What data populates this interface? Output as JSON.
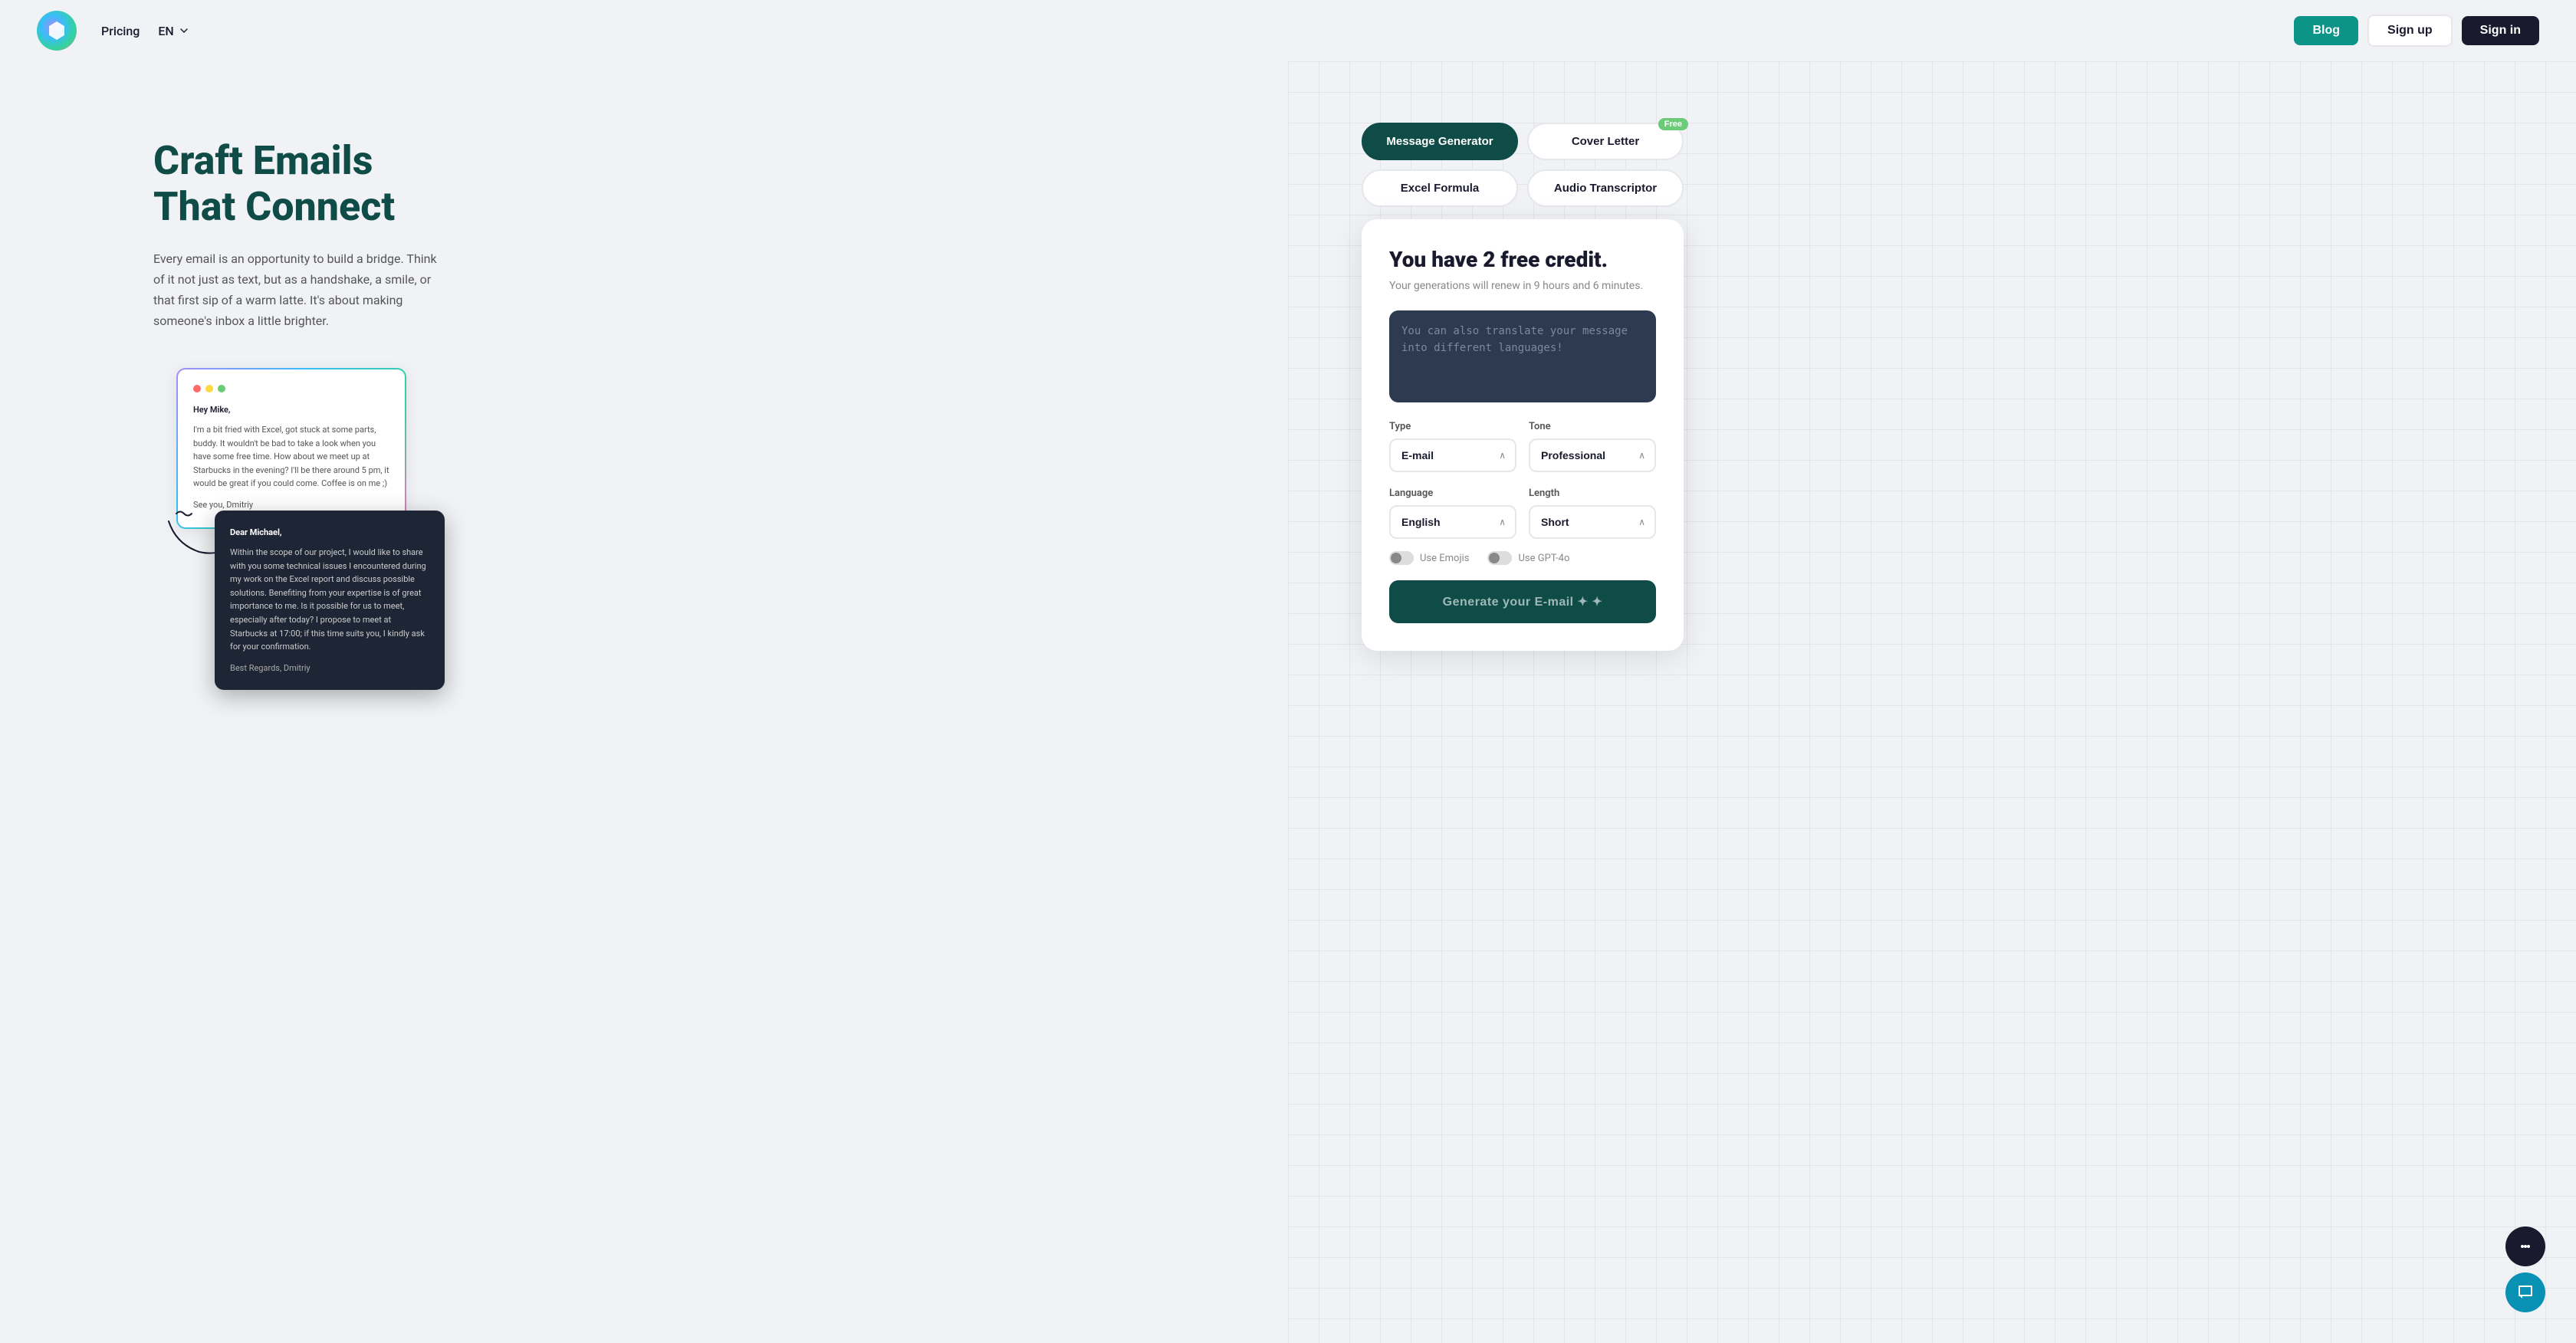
{
  "nav": {
    "pricing_label": "Pricing",
    "lang_label": "EN",
    "blog_label": "Blog",
    "signup_label": "Sign up",
    "signin_label": "Sign in"
  },
  "hero": {
    "title": "Craft Emails That Connect",
    "description": "Every email is an opportunity to build a bridge. Think of it not just as text, but as a handshake, a smile, or that first sip of a warm latte. It's about making someone's inbox a little brighter."
  },
  "email_light": {
    "greeting": "Hey Mike,",
    "body": "I'm a bit fried with Excel, got stuck at some parts, buddy. It wouldn't be bad to take a look when you have some free time. How about we meet up at Starbucks in the evening? I'll be there around 5 pm, it would be great if you could come. Coffee is on me ;)",
    "sign": "See you, Dmitriy"
  },
  "email_dark": {
    "greeting": "Dear Michael,",
    "body": "Within the scope of our project, I would like to share with you some technical issues I encountered during my work on the Excel report and discuss possible solutions. Benefiting from your expertise is of great importance to me. Is it possible for us to meet, especially after today? I propose to meet at Starbucks at 17:00; if this time suits you, I kindly ask for your confirmation.",
    "sign": "Best Regards, Dmitriy"
  },
  "tabs": [
    {
      "id": "message",
      "label": "Message Generator",
      "active": true,
      "badge": null
    },
    {
      "id": "cover",
      "label": "Cover Letter",
      "active": false,
      "badge": "Free"
    },
    {
      "id": "excel",
      "label": "Excel Formula",
      "active": false,
      "badge": null
    },
    {
      "id": "audio",
      "label": "Audio Transcriptor",
      "active": false,
      "badge": null
    }
  ],
  "card": {
    "title": "You have 2 free credit.",
    "subtitle": "Your generations will renew in 9 hours and 6 minutes.",
    "textarea_placeholder": "You can also translate your message into different languages!",
    "type_label": "Type",
    "tone_label": "Tone",
    "language_label": "Language",
    "length_label": "Length",
    "type_value": "E-mail",
    "tone_value": "Professional",
    "language_value": "English",
    "length_value": "Short",
    "toggle_emojis": "Use Emojis",
    "toggle_gpt": "Use GPT-4o",
    "generate_btn": "Generate your E-mail ✦ ✦"
  }
}
